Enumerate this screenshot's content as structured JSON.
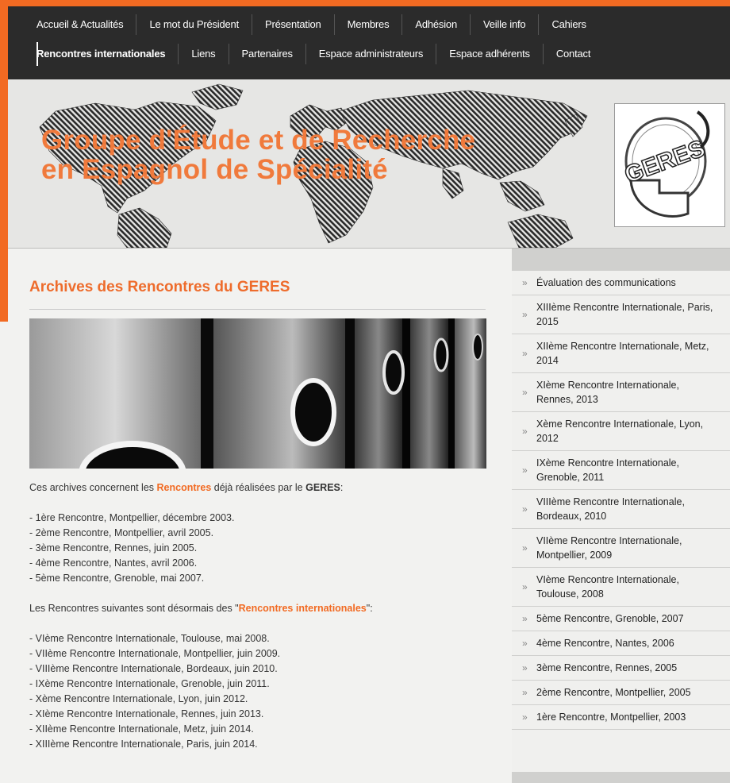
{
  "nav": {
    "row1": [
      "Accueil & Actualités",
      "Le mot du Président",
      "Présentation",
      "Membres",
      "Adhésion",
      "Veille info",
      "Cahiers"
    ],
    "row2": [
      "Rencontres internationales",
      "Liens",
      "Partenaires",
      "Espace administrateurs",
      "Espace adhérents",
      "Contact"
    ]
  },
  "header": {
    "title_line1": "Groupe d'Étude et de Recherche",
    "title_line2": "en Espagnol de Spécialité",
    "logo_text": "GERES"
  },
  "main": {
    "page_title": "Archives des Rencontres du GERES",
    "intro_prefix": "Ces archives concernent les ",
    "intro_link": "Rencontres",
    "intro_middle": " déjà réalisées par le ",
    "intro_bold": "GERES",
    "intro_suffix": ":",
    "list1": [
      "- 1ère Rencontre, Montpellier, décembre 2003.",
      "- 2ème Rencontre, Montpellier, avril 2005.",
      "- 3ème Rencontre, Rennes, juin 2005.",
      "- 4ème Rencontre, Nantes, avril 2006.",
      "- 5ème Rencontre, Grenoble, mai 2007."
    ],
    "para2_prefix": "Les Rencontres suivantes sont désormais des \"",
    "para2_link": "Rencontres internationales",
    "para2_suffix": "\":",
    "list2": [
      "- VIème Rencontre Internationale, Toulouse, mai 2008.",
      "- VIIème Rencontre Internationale, Montpellier, juin 2009.",
      "- VIIIème Rencontre Internationale, Bordeaux, juin 2010.",
      "- IXème Rencontre Internationale, Grenoble, juin 2011.",
      "- Xème Rencontre Internationale, Lyon, juin 2012.",
      "- XIème Rencontre Internationale, Rennes, juin 2013.",
      "- XIIème Rencontre Internationale, Metz, juin 2014.",
      "- XIIIème Rencontre Internationale, Paris, juin 2014."
    ]
  },
  "sidebar": {
    "items": [
      {
        "lines": [
          "Évaluation des communications"
        ]
      },
      {
        "lines": [
          "XIIIème Rencontre Internationale, Paris,",
          "2015"
        ]
      },
      {
        "lines": [
          "XIIème Rencontre Internationale, Metz,",
          "2014"
        ]
      },
      {
        "lines": [
          "XIème Rencontre Internationale,",
          "Rennes, 2013"
        ]
      },
      {
        "lines": [
          "Xème Rencontre Internationale, Lyon,",
          "2012"
        ]
      },
      {
        "lines": [
          "IXème Rencontre Internationale,",
          "Grenoble, 2011"
        ]
      },
      {
        "lines": [
          "VIIIème Rencontre Internationale,",
          "Bordeaux, 2010"
        ]
      },
      {
        "lines": [
          "VIIème Rencontre Internationale,",
          "Montpellier, 2009"
        ]
      },
      {
        "lines": [
          "VIème Rencontre Internationale,",
          "Toulouse, 2008"
        ]
      },
      {
        "lines": [
          "5ème Rencontre, Grenoble, 2007"
        ]
      },
      {
        "lines": [
          "4ème Rencontre, Nantes, 2006"
        ]
      },
      {
        "lines": [
          "3ème Rencontre, Rennes, 2005"
        ]
      },
      {
        "lines": [
          "2ème Rencontre, Montpellier, 2005"
        ]
      },
      {
        "lines": [
          "1ère Rencontre, Montpellier, 2003"
        ]
      }
    ]
  },
  "colors": {
    "accent": "#f26a22",
    "nav_bg": "#2b2b2b"
  }
}
